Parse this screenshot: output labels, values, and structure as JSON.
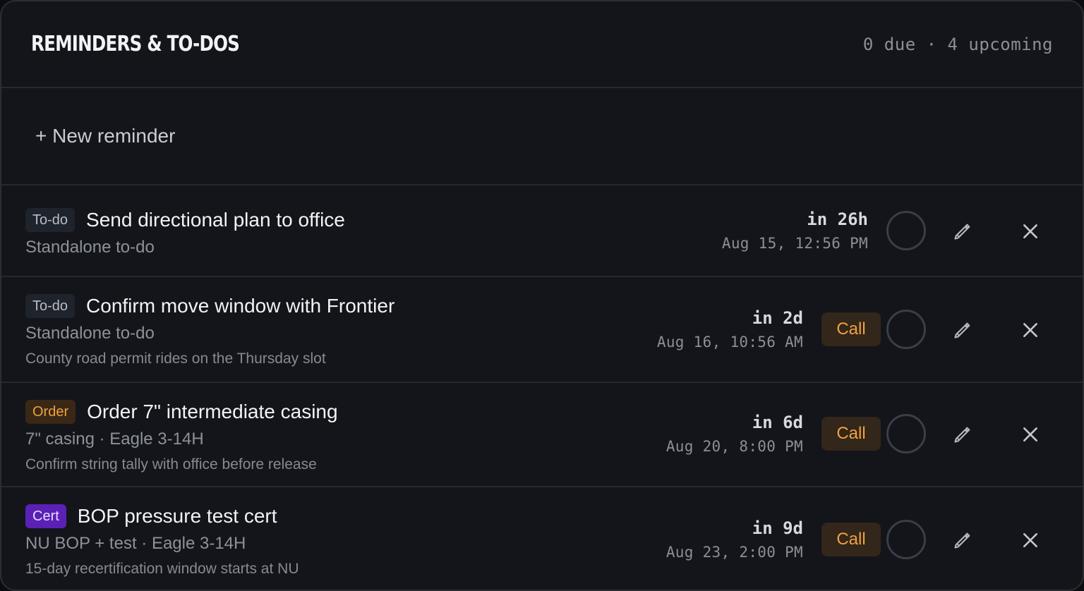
{
  "header": {
    "title": "REMINDERS & TO-DOS",
    "summary": "0 due · 4 upcoming"
  },
  "new_reminder_label": "+ New reminder",
  "icons": {
    "complete": "circle-check-icon",
    "edit": "pencil-icon",
    "delete": "close-icon"
  },
  "colors": {
    "todo_badge": "#1f232b",
    "order_badge": "#3a2716",
    "cert_badge": "#5b21b6",
    "call_button": "#33261a",
    "call_text": "#f0a23e"
  },
  "reminders": [
    {
      "badge": "To-do",
      "title": "Send directional plan to office",
      "subtitle": "Standalone to-do",
      "note": "",
      "relative": "in 26h",
      "absolute": "Aug 15, 12:56 PM",
      "call_label": ""
    },
    {
      "badge": "To-do",
      "title": "Confirm move window with Frontier",
      "subtitle": "Standalone to-do",
      "note": "County road permit rides on the Thursday slot",
      "relative": "in 2d",
      "absolute": "Aug 16, 10:56 AM",
      "call_label": "Call"
    },
    {
      "badge": "Order",
      "title": "Order 7\" intermediate casing",
      "subtitle": "7\" casing · Eagle 3-14H",
      "note": "Confirm string tally with office before release",
      "relative": "in 6d",
      "absolute": "Aug 20, 8:00 PM",
      "call_label": "Call"
    },
    {
      "badge": "Cert",
      "title": "BOP pressure test cert",
      "subtitle": "NU BOP + test · Eagle 3-14H",
      "note": "15-day recertification window starts at NU",
      "relative": "in 9d",
      "absolute": "Aug 23, 2:00 PM",
      "call_label": "Call"
    }
  ]
}
